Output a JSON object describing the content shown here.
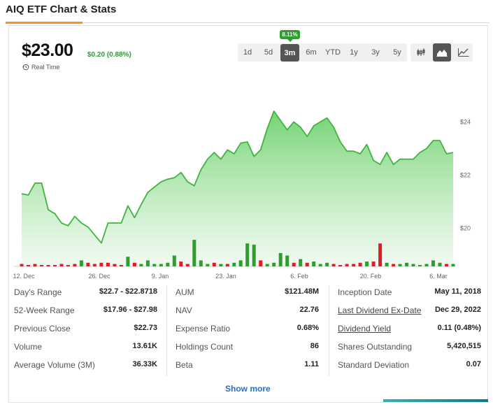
{
  "page": {
    "title": "AIQ ETF Chart & Stats"
  },
  "quote": {
    "price": "$23.00",
    "change": "$0.20 (0.88%)",
    "realtime_label": "Real Time",
    "period_change_badge": "8.11%"
  },
  "range_buttons": [
    {
      "label": "1d",
      "active": false
    },
    {
      "label": "5d",
      "active": false
    },
    {
      "label": "3m",
      "active": true
    },
    {
      "label": "6m",
      "active": false
    },
    {
      "label": "YTD",
      "active": false
    },
    {
      "label": "1y",
      "active": false
    },
    {
      "label": "3y",
      "active": false
    },
    {
      "label": "5y",
      "active": false
    }
  ],
  "chart_type_buttons": [
    {
      "icon": "candlestick-icon",
      "active": false
    },
    {
      "icon": "mountain-chart-icon",
      "active": true
    },
    {
      "icon": "line-chart-icon",
      "active": false
    }
  ],
  "chart_data": {
    "type": "area",
    "title": "",
    "xlabel": "",
    "ylabel": "",
    "x_tick_labels": [
      "12. Dec",
      "26. Dec",
      "9. Jan",
      "23. Jan",
      "6. Feb",
      "20. Feb",
      "6. Mar"
    ],
    "y_tick_labels": [
      "$20",
      "$22",
      "$24"
    ],
    "ylim": [
      18.6,
      24.9
    ],
    "price": [
      21.3,
      21.25,
      21.7,
      21.7,
      20.7,
      20.55,
      20.2,
      20.1,
      20.45,
      20.2,
      20.05,
      19.75,
      19.45,
      20.2,
      20.2,
      20.2,
      20.85,
      20.4,
      20.9,
      21.35,
      21.55,
      21.75,
      21.85,
      21.9,
      22.1,
      21.75,
      21.6,
      22.2,
      22.6,
      22.85,
      22.6,
      22.95,
      22.8,
      23.2,
      23.25,
      22.7,
      22.95,
      23.75,
      24.4,
      24.05,
      23.7,
      24.0,
      23.8,
      23.45,
      23.85,
      24.0,
      24.15,
      23.8,
      23.25,
      22.9,
      22.9,
      22.8,
      23.15,
      22.55,
      22.4,
      22.85,
      22.4,
      22.6,
      22.6,
      22.6,
      22.85,
      23.0,
      23.3,
      23.3,
      22.8,
      22.85
    ],
    "volume": [
      2,
      1,
      2,
      1,
      1,
      1,
      2,
      1,
      2,
      5,
      3,
      2,
      3,
      3,
      2,
      1,
      8,
      3,
      2,
      5,
      2,
      2,
      3,
      9,
      4,
      2,
      22,
      5,
      2,
      3,
      2,
      2,
      3,
      5,
      19,
      18,
      5,
      2,
      3,
      11,
      9,
      3,
      6,
      3,
      4,
      2,
      3,
      2,
      1,
      2,
      2,
      3,
      4,
      4,
      19,
      3,
      2,
      2,
      3,
      2,
      1,
      2,
      5,
      3,
      2,
      2
    ],
    "volume_up": [
      false,
      false,
      false,
      false,
      false,
      false,
      false,
      false,
      false,
      true,
      false,
      false,
      false,
      false,
      false,
      false,
      true,
      false,
      true,
      true,
      true,
      true,
      true,
      true,
      false,
      false,
      true,
      true,
      true,
      false,
      true,
      false,
      true,
      true,
      true,
      true,
      false,
      true,
      true,
      true,
      true,
      false,
      true,
      false,
      true,
      true,
      true,
      false,
      false,
      false,
      false,
      false,
      true,
      false,
      false,
      true,
      false,
      true,
      true,
      true,
      true,
      true,
      true,
      true,
      false,
      true
    ]
  },
  "stats": {
    "col1": [
      {
        "label": "Day's Range",
        "value": "$22.7 - $22.8718",
        "link": false
      },
      {
        "label": "52-Week Range",
        "value": "$17.96 - $27.98",
        "link": false
      },
      {
        "label": "Previous Close",
        "value": "$22.73",
        "link": false
      },
      {
        "label": "Volume",
        "value": "13.61K",
        "link": false
      },
      {
        "label": "Average Volume (3M)",
        "value": "36.33K",
        "link": false
      }
    ],
    "col2": [
      {
        "label": "AUM",
        "value": "$121.48M",
        "link": false
      },
      {
        "label": "NAV",
        "value": "22.76",
        "link": false
      },
      {
        "label": "Expense Ratio",
        "value": "0.68%",
        "link": false
      },
      {
        "label": "Holdings Count",
        "value": "86",
        "link": false
      },
      {
        "label": "Beta",
        "value": "1.11",
        "link": false
      }
    ],
    "col3": [
      {
        "label": "Inception Date",
        "value": "May 11, 2018",
        "link": false
      },
      {
        "label": "Last Dividend Ex-Date",
        "value": "Dec 29, 2022",
        "link": true
      },
      {
        "label": "Dividend Yield",
        "value": "0.11 (0.48%)",
        "link": true
      },
      {
        "label": "Shares Outstanding",
        "value": "5,420,515",
        "link": false
      },
      {
        "label": "Standard Deviation",
        "value": "0.07",
        "link": false
      }
    ]
  },
  "show_more_label": "Show more",
  "colors": {
    "accent": "#f7931e",
    "up": "#2e9e2e",
    "down": "#d9202a",
    "line": "#3fb53f",
    "link": "#2a6dc2"
  }
}
